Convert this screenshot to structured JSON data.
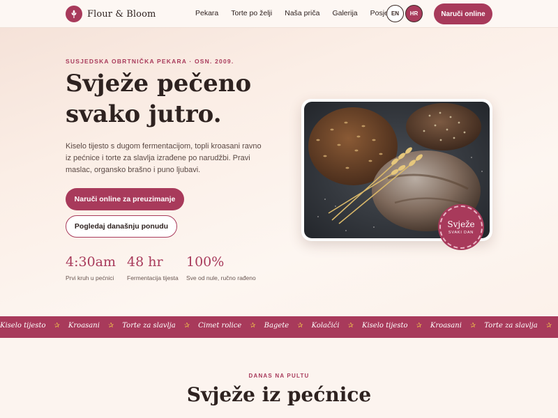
{
  "brand": {
    "name": "Flour & Bloom",
    "logo_icon": "wheat-icon"
  },
  "nav": {
    "items": [
      "Pekara",
      "Torte po želji",
      "Naša priča",
      "Galerija",
      "Posjeti"
    ]
  },
  "lang": {
    "options": [
      "EN",
      "HR"
    ],
    "selected": "HR"
  },
  "header": {
    "order_label": "Naruči online"
  },
  "hero": {
    "eyebrow": "SUSJEDSKA OBRTNIČKA PEKARA · OSN. 2009.",
    "title_line1": "Svježe pečeno",
    "title_line2": "svako jutro.",
    "description": "Kiselo tijesto s dugom fermentacijom, topli kroasani ravno iz pećnice i torte za slavlja izrađene po narudžbi. Pravi maslac, organsko brašno i puno ljubavi.",
    "primary_cta": "Naruči online za preuzimanje",
    "secondary_cta": "Pogledaj današnju ponudu",
    "stats": [
      {
        "value": "4:30am",
        "label": "Prvi kruh u pećnici"
      },
      {
        "value": "48 hr",
        "label": "Fermentacija tijesta"
      },
      {
        "value": "100%",
        "label": "Sve od nule, ručno rađeno"
      }
    ],
    "badge": {
      "line1": "Svježe",
      "line2": "SVAKI DAN"
    }
  },
  "ticker": {
    "items": [
      "Kiselo tijesto",
      "Kroasani",
      "Torte za slavlja",
      "Cimet rolice",
      "Bagete",
      "Kolačići",
      "Kiselo tijesto",
      "Kroasani",
      "Torte za slavlja",
      "Cimet rolice"
    ],
    "separator_icon": "star-icon"
  },
  "section": {
    "eyebrow": "DANAS NA PULTU",
    "title": "Svježe iz pećnice"
  },
  "colors": {
    "accent": "#a83a5b",
    "star": "#f0c24b",
    "background": "#fcf4ef",
    "text": "#2e2220"
  }
}
